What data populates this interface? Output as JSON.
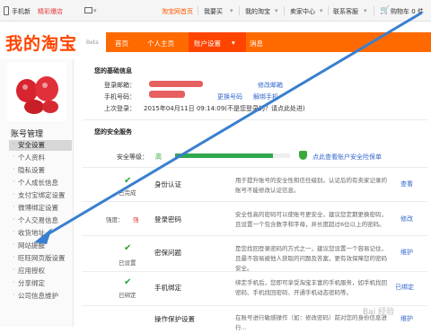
{
  "topbar": {
    "phone": "手机新",
    "promo": "精彩爆店",
    "account_center": "淘宝网首页",
    "my_taobao": "我要买",
    "my_taobao_menu": "我的淘宝",
    "seller_center": "卖家中心",
    "contact_service": "联系客服",
    "cart": "购物车 0 件"
  },
  "header": {
    "logo": "我的淘宝",
    "beta": "Beta",
    "nav": [
      "首页",
      "个人主页",
      "账户设置",
      "消息"
    ]
  },
  "sidebar": {
    "title": "账号管理",
    "items": [
      {
        "label": "安全设置",
        "active": true
      },
      {
        "label": "个人资料"
      },
      {
        "label": "隐私设置"
      },
      {
        "label": "个人成长信息"
      },
      {
        "label": "支付宝绑定设置"
      },
      {
        "label": "微博绑定设置"
      },
      {
        "label": "个人交易信息"
      },
      {
        "label": "收货地址"
      },
      {
        "label": "网站提醒"
      },
      {
        "label": "旺旺网页版设置"
      },
      {
        "label": "应用授权"
      },
      {
        "label": "分享绑定"
      },
      {
        "label": "公司信息维护"
      }
    ]
  },
  "basic_info": {
    "heading": "您的基础信息",
    "email_label": "登录邮箱：",
    "email_link": "修改邮箱",
    "phone_label": "手机号码：",
    "phone_link": "更换号码",
    "phone_link2": "解绑手机",
    "last_login_label": "上次登录：",
    "last_login_value": "2015年04月11日 09:14:09(不是您登录的？请点此处进)"
  },
  "security": {
    "heading": "您的安全服务",
    "level_label": "安全等级：",
    "level_value": "高",
    "level_fraction": 0.85,
    "level_link": "点此查看账户安全险保单",
    "rows": [
      {
        "status": "已完成",
        "name": "身份认证",
        "desc": "用于提升账号的安全性和信任级别。认证后的有卖家记录的账号不能修改认证信息。",
        "action": "查看"
      },
      {
        "status_prefix": "强度：",
        "status": "强",
        "name": "登录密码",
        "desc": "安全性高的密码可以使账号更安全，建议您定期更换密码，且设置一个包含数字和字母，并长度超过6位以上的密码。",
        "action": "修改"
      },
      {
        "status": "已设置",
        "name": "密保问题",
        "desc": "是您找回登录密码的方式之一，建议您设置一个容易记住，且最不容易被他人获取的问题及答案，更有效保障您的密码安全。",
        "action": "维护"
      },
      {
        "status": "已绑定",
        "name": "手机绑定",
        "desc": "绑定手机后，您即可享受淘宝丰富的手机服务，如手机找回密码、手机找回密码、开通手机动态密码等。",
        "action": "已绑定"
      },
      {
        "status": "",
        "name": "操作保护设置",
        "desc": "在账号进行敏感操作（如：修改密码）前对您的身份信息进行...",
        "action": "维护"
      }
    ]
  },
  "watermark": "Bai 经验",
  "colors": {
    "brand": "#ff6a00",
    "brand_dark": "#ff4400",
    "link": "#3366cc",
    "ok": "#29a336"
  }
}
